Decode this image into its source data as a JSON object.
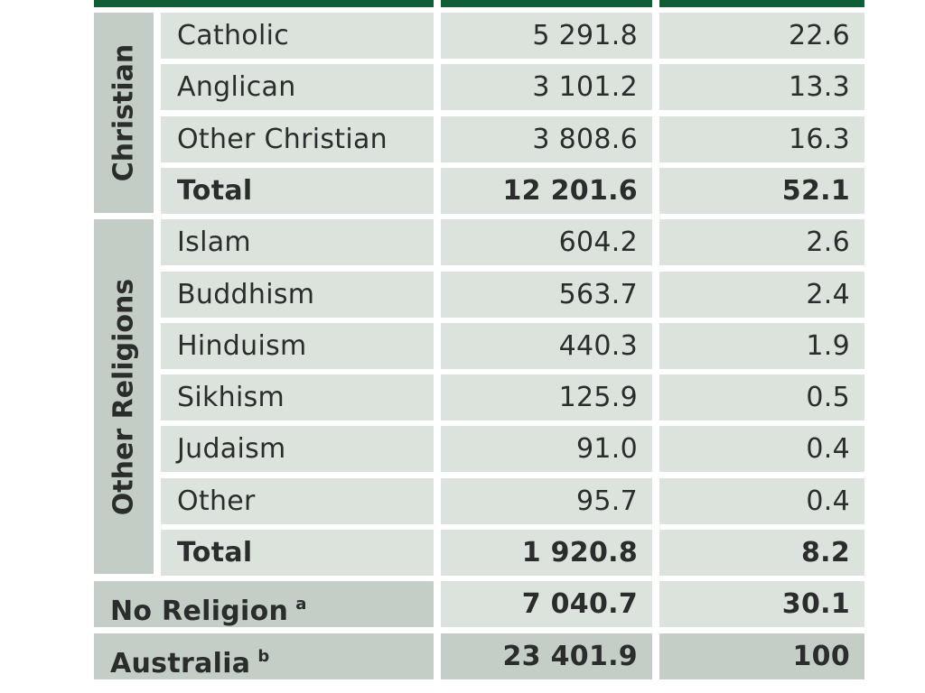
{
  "table": {
    "header_color": "#0f5e36",
    "groups": [
      {
        "label": "Christian",
        "rows": [
          {
            "name": "Catholic",
            "number": "5 291.8",
            "percent": "22.6"
          },
          {
            "name": "Anglican",
            "number": "3 101.2",
            "percent": "13.3"
          },
          {
            "name": "Other Christian",
            "number": "3 808.6",
            "percent": "16.3"
          },
          {
            "name": "Total",
            "number": "12 201.6",
            "percent": "52.1",
            "bold": true
          }
        ]
      },
      {
        "label": "Other Religions",
        "rows": [
          {
            "name": "Islam",
            "number": "604.2",
            "percent": "2.6"
          },
          {
            "name": "Buddhism",
            "number": "563.7",
            "percent": "2.4"
          },
          {
            "name": "Hinduism",
            "number": "440.3",
            "percent": "1.9"
          },
          {
            "name": "Sikhism",
            "number": "125.9",
            "percent": "0.5"
          },
          {
            "name": "Judaism",
            "number": "91.0",
            "percent": "0.4"
          },
          {
            "name": "Other",
            "number": "95.7",
            "percent": "0.4"
          },
          {
            "name": "Total",
            "number": "1 920.8",
            "percent": "8.2",
            "bold": true
          }
        ]
      }
    ],
    "summary_rows": [
      {
        "name": "No Religion",
        "footnote": "a",
        "number": "7 040.7",
        "percent": "30.1"
      },
      {
        "name": "Australia",
        "footnote": "b",
        "number": "23 401.9",
        "percent": "100"
      }
    ]
  }
}
